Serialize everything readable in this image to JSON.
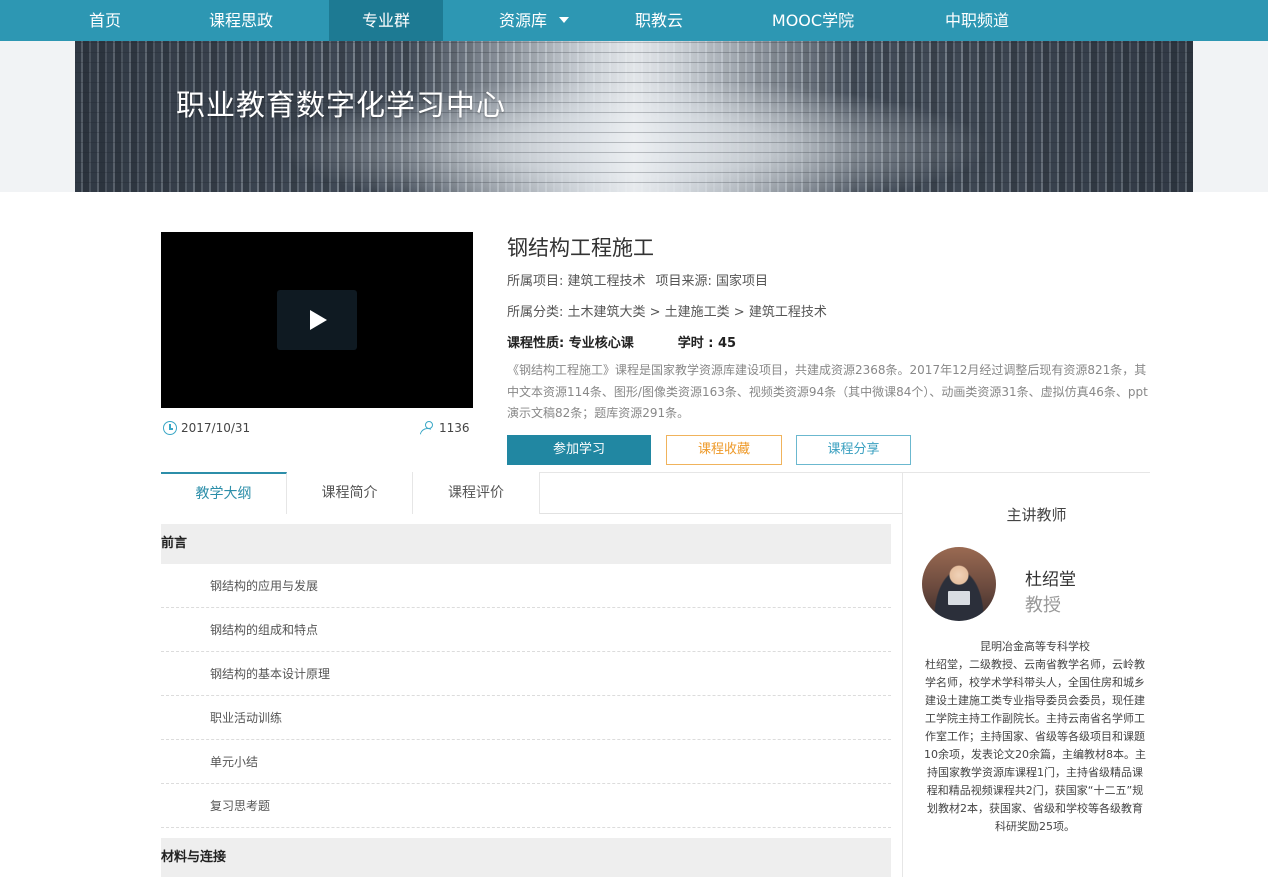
{
  "nav": {
    "items": [
      {
        "label": "首页"
      },
      {
        "label": "课程思政"
      },
      {
        "label": "专业群"
      },
      {
        "label": "资源库"
      },
      {
        "label": "职教云"
      },
      {
        "label": "MOOC学院"
      },
      {
        "label": "中职频道"
      }
    ],
    "active": "专业群"
  },
  "banner": {
    "title": "职业教育数字化学习中心"
  },
  "course": {
    "date": "2017/10/31",
    "count": "1136",
    "title": "钢结构工程施工",
    "project": "所属项目: 建筑工程技术",
    "source": "项目来源: 国家项目",
    "category": "所属分类: 土木建筑大类 > 土建施工类 > 建筑工程技术",
    "nature": "课程性质: 专业核心课",
    "hours": "学时 : 45",
    "description": "《钢结构工程施工》课程是国家教学资源库建设项目，共建成资源2368条。2017年12月经过调整后现有资源821条，其中文本资源114条、图形/图像类资源163条、视频类资源94条（其中微课84个）、动画类资源31条、虚拟仿真46条、ppt演示文稿82条；题库资源291条。",
    "buttons": {
      "join": "参加学习",
      "favorite": "课程收藏",
      "share": "课程分享"
    }
  },
  "tabs": [
    {
      "label": "教学大纲"
    },
    {
      "label": "课程简介"
    },
    {
      "label": "课程评价"
    }
  ],
  "syllabus": {
    "sections": [
      {
        "title": "前言",
        "lessons": [
          {
            "label": "钢结构的应用与发展"
          },
          {
            "label": "钢结构的组成和特点"
          },
          {
            "label": "钢结构的基本设计原理"
          },
          {
            "label": "职业活动训练"
          },
          {
            "label": "单元小结"
          },
          {
            "label": "复习思考题"
          }
        ]
      },
      {
        "title": "材料与连接",
        "lessons": []
      }
    ]
  },
  "teacher": {
    "heading": "主讲教师",
    "name": "杜绍堂",
    "title": "教授",
    "bio": "昆明冶金高等专科学校\n杜绍堂，二级教授、云南省教学名师，云岭教学名师，校学术学科带头人，全国住房和城乡建设土建施工类专业指导委员会委员，现任建工学院主持工作副院长。主持云南省名学师工作室工作；主持国家、省级等各级项目和课题10余项，发表论文20余篇，主编教材8本。主持国家教学资源库课程1门，主持省级精品课程和精品视频课程共2门，获国家“十二五”规划教材2本，获国家、省级和学校等各级教育科研奖励25项。"
  },
  "colors": {
    "nav_bg": "#2d97b3",
    "nav_active": "#1d7a93",
    "primary_button": "#2187a2",
    "favorite_border": "#f0b35c",
    "share_border": "#6bb8cf"
  }
}
